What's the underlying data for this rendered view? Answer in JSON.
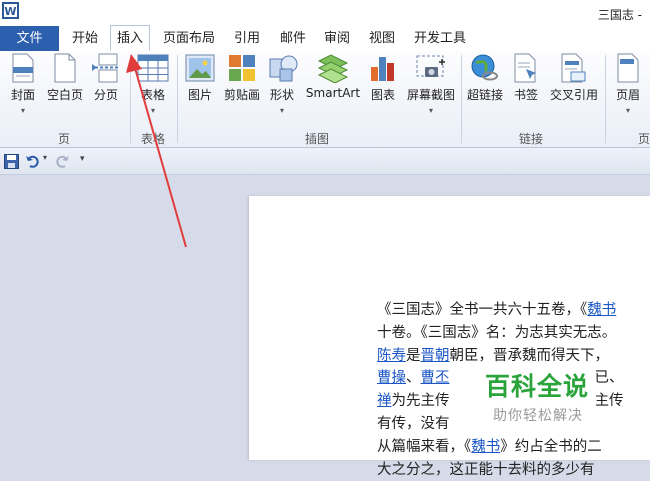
{
  "window": {
    "title": "三国志 -"
  },
  "tabs": {
    "file": "文件",
    "items": [
      "开始",
      "插入",
      "页面布局",
      "引用",
      "邮件",
      "审阅",
      "视图",
      "开发工具"
    ],
    "active_index": 1
  },
  "ribbon": {
    "pages_group": {
      "label": "页",
      "cover": "封面",
      "blank": "空白页",
      "page_break": "分页"
    },
    "table_group": {
      "label": "表格",
      "table": "表格"
    },
    "illustrations_group": {
      "label": "插图",
      "picture": "图片",
      "clipart": "剪贴画",
      "shapes": "形状",
      "smartart": "SmartArt",
      "chart": "图表",
      "screenshot": "屏幕截图"
    },
    "links_group": {
      "label": "链接",
      "hyperlink": "超链接",
      "bookmark": "书签",
      "crossref": "交叉引用"
    },
    "header_group": {
      "label": "页",
      "header": "页眉"
    }
  },
  "document": {
    "line1_a": "《三国志》全书一共六十五卷，《",
    "line1_link": "魏书",
    "line2": "十卷。《三国志》名：为志其实无志。",
    "line3_link1": "陈寿",
    "line3_a": "是",
    "line3_link2": "晋朝",
    "line3_b": "朝臣，晋承魏而得天下，",
    "line4_link1": "曹操",
    "line4_a": "、",
    "line4_link2": "曹丕",
    "line4_b": "　　　　　　　　　　已、",
    "line5_link": "禅",
    "line5_a": "为先主传　　　　　　　　　　主传",
    "line6": "有传，没有",
    "line7_a": "从篇幅来看，《",
    "line7_link": "魏书",
    "line7_b": "》约占全书的二",
    "line8": "大之分之，这正能十去料的多少有"
  },
  "watermark": {
    "title": "百科全说",
    "subtitle": "助你轻松解决"
  },
  "colors": {
    "accent": "#2c5fae",
    "annotation_arrow": "#e23b3b",
    "watermark_green": "#2aa43a",
    "link": "#1a56c6"
  }
}
